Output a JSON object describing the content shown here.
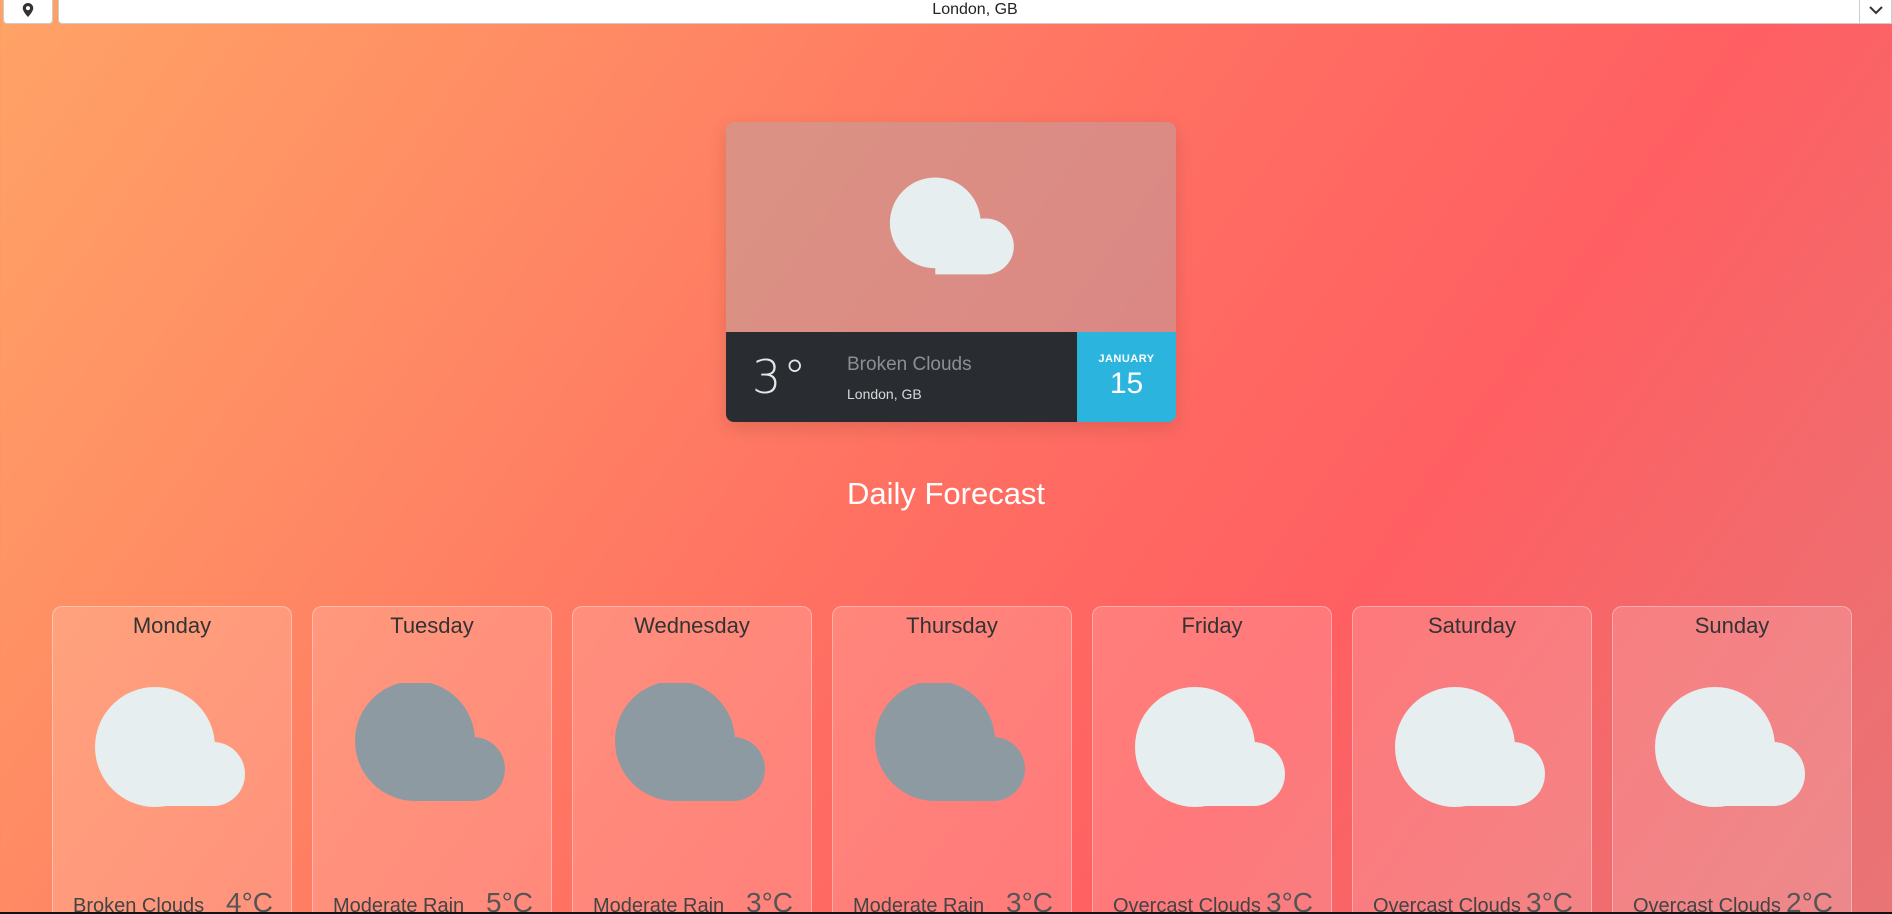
{
  "location_bar": {
    "selected": "London, GB",
    "location_icon": "map-pin-icon",
    "chevron_icon": "chevron-down-icon"
  },
  "current": {
    "temperature": "3°",
    "description": "Broken Clouds",
    "city": "London, GB",
    "month": "JANUARY",
    "day": "15",
    "icon": "cloud-icon"
  },
  "forecast": {
    "title": "Daily Forecast",
    "days": [
      {
        "name": "Monday",
        "description": "Broken Clouds",
        "temp": "4°C",
        "icon": "cloud-light-icon"
      },
      {
        "name": "Tuesday",
        "description": "Moderate Rain",
        "temp": "5°C",
        "icon": "cloud-dark-icon"
      },
      {
        "name": "Wednesday",
        "description": "Moderate Rain",
        "temp": "3°C",
        "icon": "cloud-dark-icon"
      },
      {
        "name": "Thursday",
        "description": "Moderate Rain",
        "temp": "3°C",
        "icon": "cloud-dark-icon"
      },
      {
        "name": "Friday",
        "description": "Overcast Clouds",
        "temp": "3°C",
        "icon": "cloud-light-icon"
      },
      {
        "name": "Saturday",
        "description": "Overcast Clouds",
        "temp": "3°C",
        "icon": "cloud-light-icon"
      },
      {
        "name": "Sunday",
        "description": "Overcast Clouds",
        "temp": "2°C",
        "icon": "cloud-light-icon"
      }
    ]
  },
  "colors": {
    "cloud_light": "#e6eef0",
    "cloud_dark": "#8e9aa1",
    "card_dark": "#292d32",
    "date_accent": "#2bb4de"
  }
}
